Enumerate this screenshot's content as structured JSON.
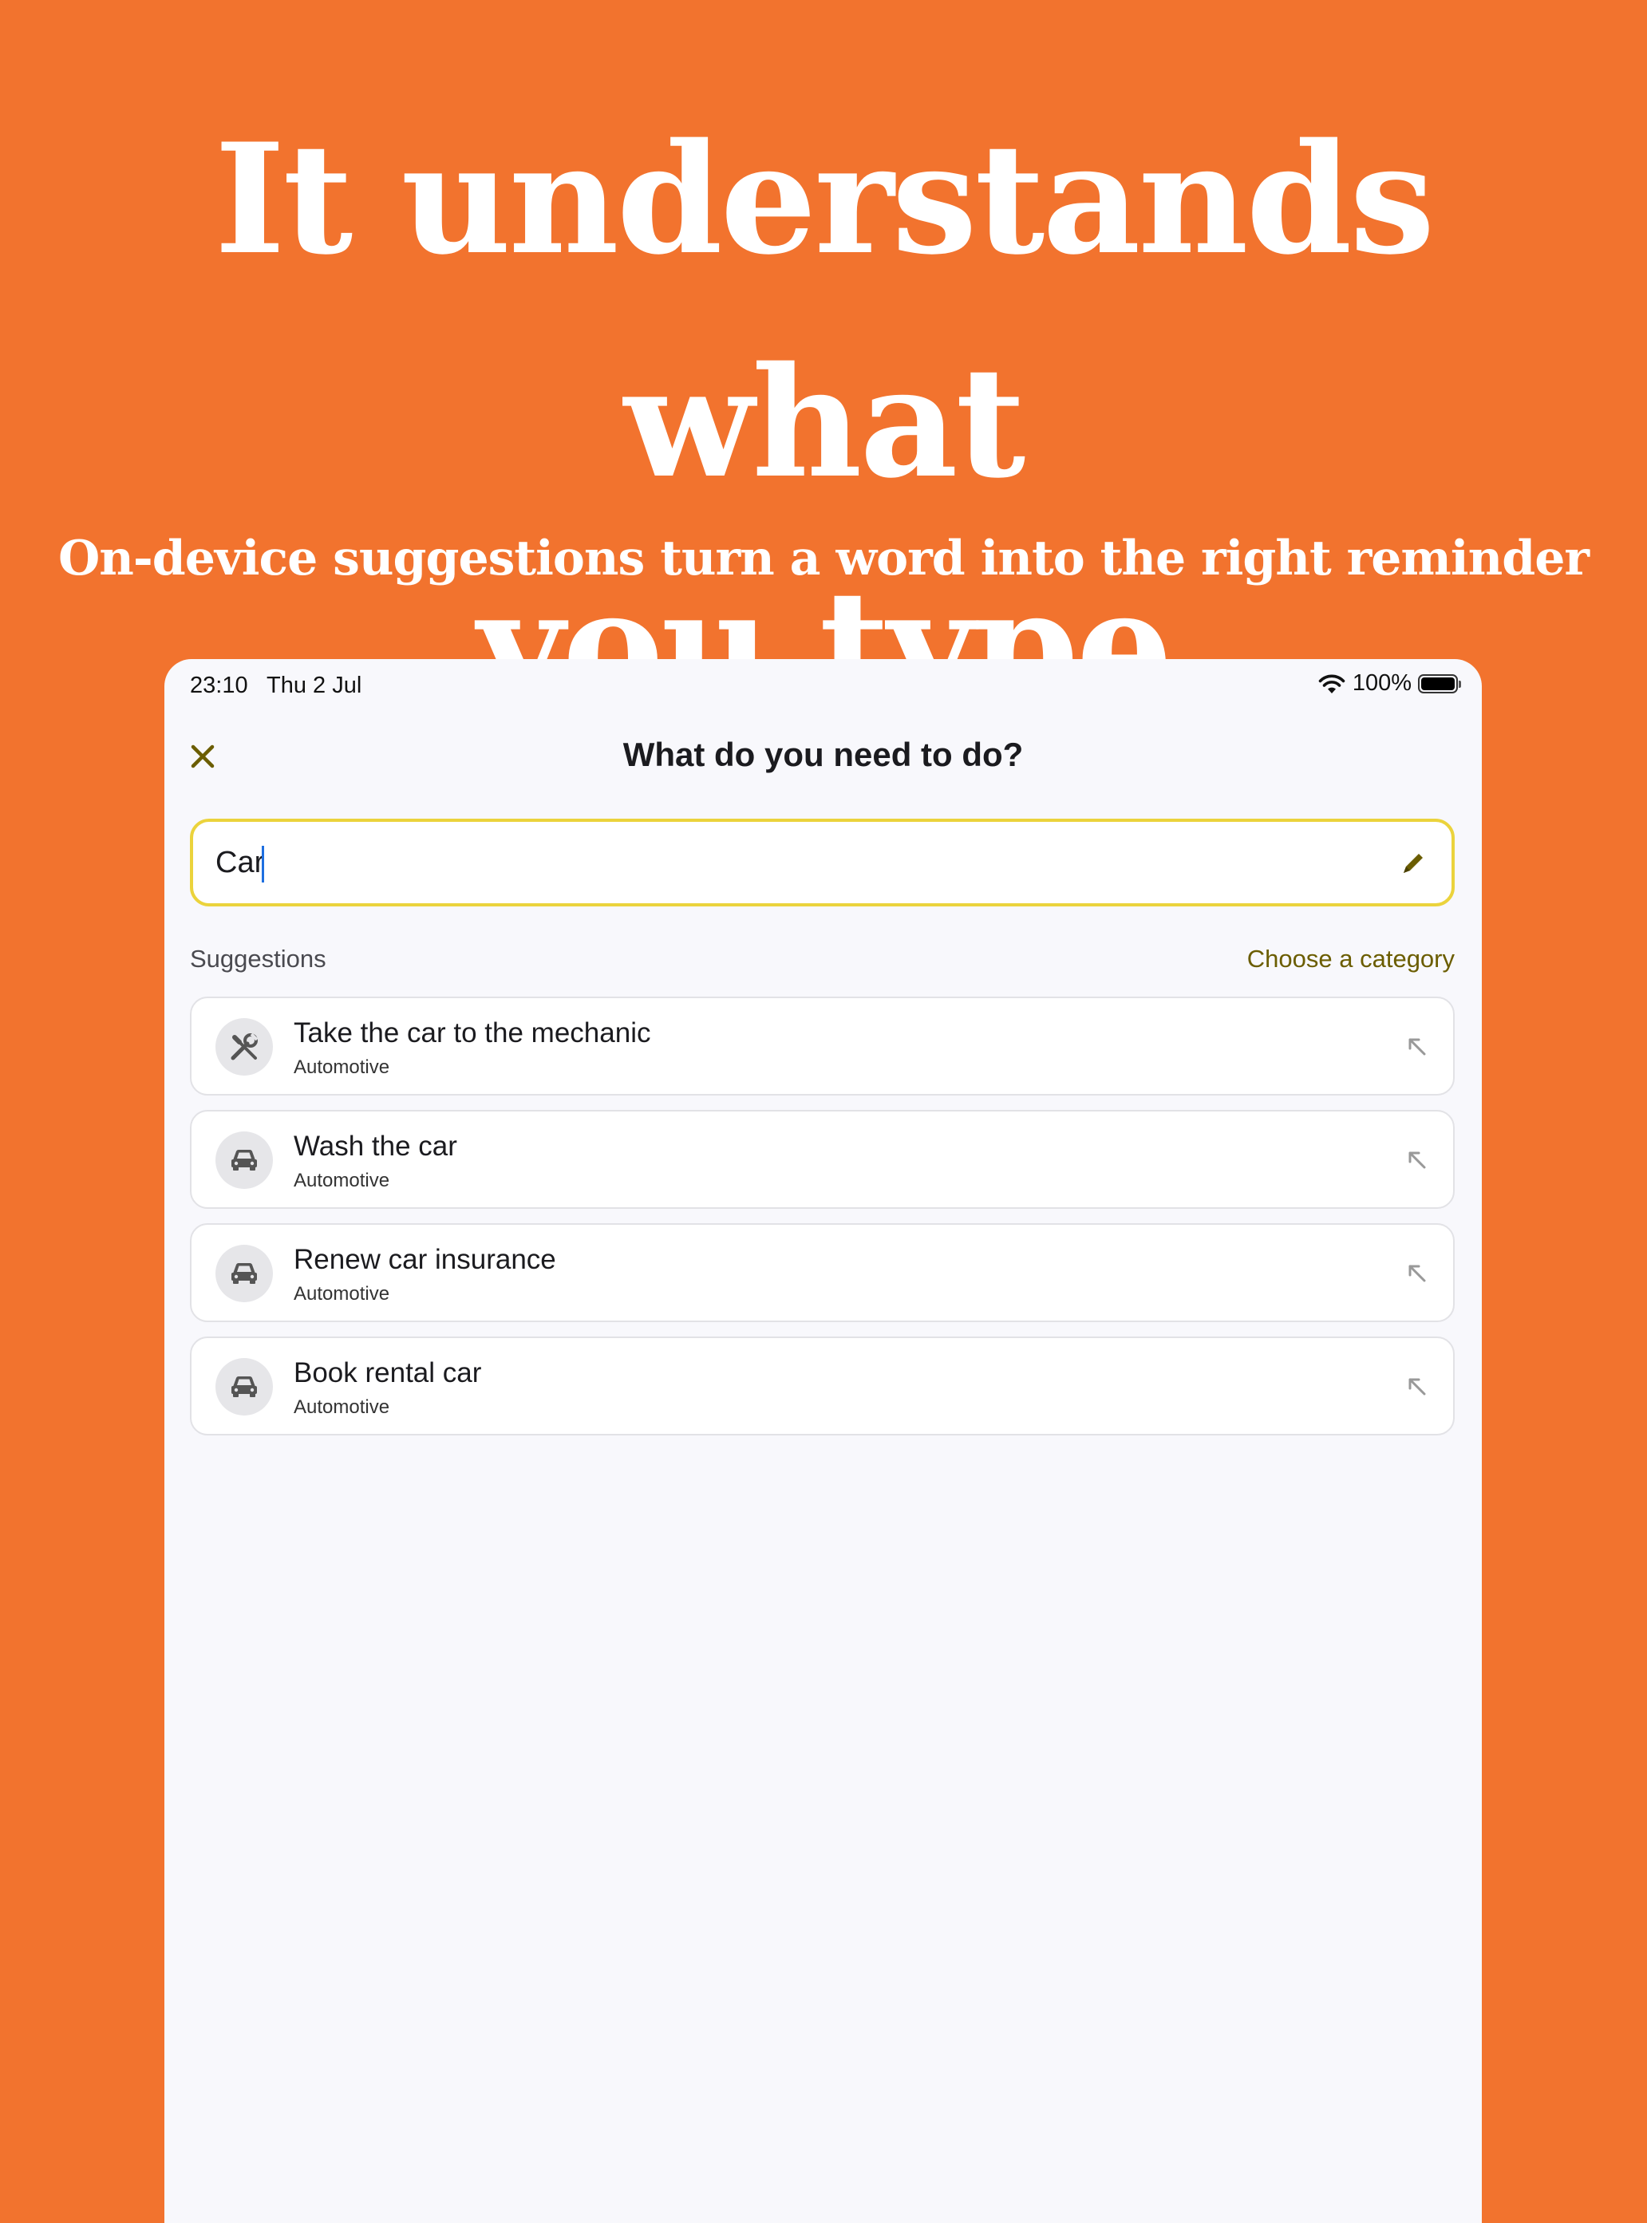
{
  "promo": {
    "headline_line1": "It understands what",
    "headline_line2": "you type",
    "subheadline": "On-device suggestions turn a word into the right reminder",
    "background_color": "#F2732E"
  },
  "status_bar": {
    "time": "23:10",
    "date": "Thu 2 Jul",
    "battery": "100%",
    "icons": [
      "wifi-icon",
      "battery-icon"
    ]
  },
  "modal": {
    "close_icon": "close-icon",
    "title": "What do you need to do?"
  },
  "search": {
    "value": "Car",
    "icon": "pencil-icon",
    "border_color": "#EBD33C"
  },
  "suggestions_header": {
    "label": "Suggestions",
    "link": "Choose a category",
    "link_color": "#6B5D00"
  },
  "suggestions": [
    {
      "title": "Take the car to the mechanic",
      "category": "Automotive",
      "icon": "wrench-screwdriver-icon"
    },
    {
      "title": "Wash the car",
      "category": "Automotive",
      "icon": "car-icon"
    },
    {
      "title": "Renew car insurance",
      "category": "Automotive",
      "icon": "car-icon"
    },
    {
      "title": "Book rental car",
      "category": "Automotive",
      "icon": "car-icon"
    }
  ]
}
